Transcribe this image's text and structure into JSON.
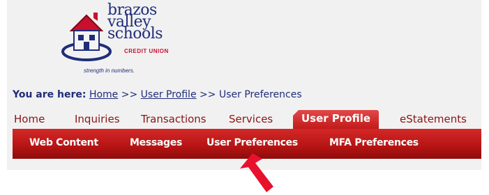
{
  "brand": {
    "words": [
      "brazos",
      "valley",
      "schools"
    ],
    "credit_union": "CREDIT UNION",
    "tagline": "strength in numbers."
  },
  "breadcrumb": {
    "label": "You are here:",
    "home": "Home",
    "separator": ">>",
    "user_profile": "User Profile",
    "current": "User Preferences"
  },
  "main_tabs": [
    "Home",
    "Inquiries",
    "Transactions",
    "Services",
    "User Profile",
    "eStatements"
  ],
  "active_tab": "User Profile",
  "sub_tabs": [
    "Web Content",
    "Messages",
    "User Preferences",
    "MFA Preferences"
  ],
  "colors": {
    "brand_blue": "#1f2d7a",
    "nav_red": "#b91515",
    "tab_text": "#8b1414",
    "arrow_red": "#e8112d"
  }
}
